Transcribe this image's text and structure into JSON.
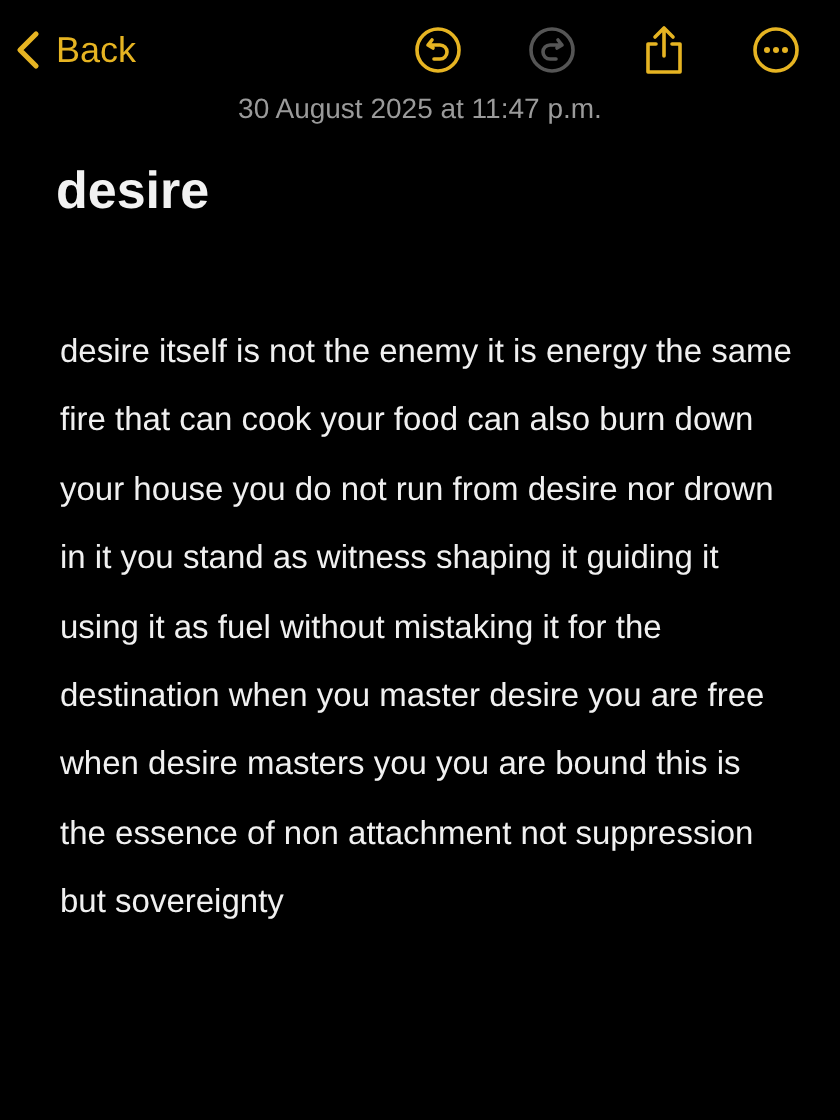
{
  "nav": {
    "back_label": "Back"
  },
  "toolbar": [
    {
      "kind": "undo",
      "disabled": false
    },
    {
      "kind": "redo",
      "disabled": true
    },
    {
      "kind": "share",
      "disabled": false
    },
    {
      "kind": "more",
      "disabled": false
    }
  ],
  "timestamp": "30 August 2025 at 11:47 p.m.",
  "note": {
    "title": "desire",
    "body": "desire itself is not the enemy it is energy the same fire that can cook your food can also burn down your house you do not run from desire nor drown in it you stand as witness shaping it guiding it using it as fuel without mistaking it for the destination when you master desire you are free when desire masters you you are bound this is the essence of non attachment not suppression but sovereignty"
  }
}
